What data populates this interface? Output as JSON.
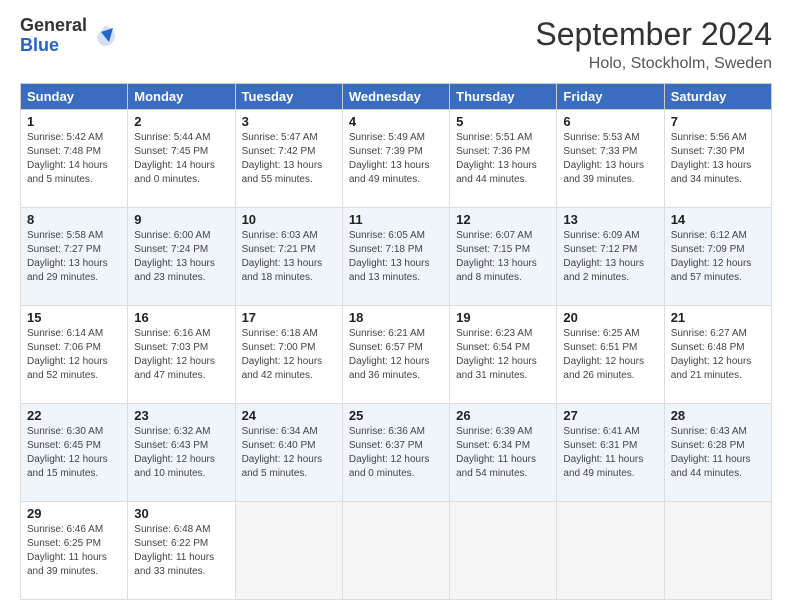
{
  "header": {
    "logo_line1": "General",
    "logo_line2": "Blue",
    "month": "September 2024",
    "location": "Holo, Stockholm, Sweden"
  },
  "days_of_week": [
    "Sunday",
    "Monday",
    "Tuesday",
    "Wednesday",
    "Thursday",
    "Friday",
    "Saturday"
  ],
  "weeks": [
    [
      {
        "day": "1",
        "sunrise": "Sunrise: 5:42 AM",
        "sunset": "Sunset: 7:48 PM",
        "daylight": "Daylight: 14 hours and 5 minutes."
      },
      {
        "day": "2",
        "sunrise": "Sunrise: 5:44 AM",
        "sunset": "Sunset: 7:45 PM",
        "daylight": "Daylight: 14 hours and 0 minutes."
      },
      {
        "day": "3",
        "sunrise": "Sunrise: 5:47 AM",
        "sunset": "Sunset: 7:42 PM",
        "daylight": "Daylight: 13 hours and 55 minutes."
      },
      {
        "day": "4",
        "sunrise": "Sunrise: 5:49 AM",
        "sunset": "Sunset: 7:39 PM",
        "daylight": "Daylight: 13 hours and 49 minutes."
      },
      {
        "day": "5",
        "sunrise": "Sunrise: 5:51 AM",
        "sunset": "Sunset: 7:36 PM",
        "daylight": "Daylight: 13 hours and 44 minutes."
      },
      {
        "day": "6",
        "sunrise": "Sunrise: 5:53 AM",
        "sunset": "Sunset: 7:33 PM",
        "daylight": "Daylight: 13 hours and 39 minutes."
      },
      {
        "day": "7",
        "sunrise": "Sunrise: 5:56 AM",
        "sunset": "Sunset: 7:30 PM",
        "daylight": "Daylight: 13 hours and 34 minutes."
      }
    ],
    [
      {
        "day": "8",
        "sunrise": "Sunrise: 5:58 AM",
        "sunset": "Sunset: 7:27 PM",
        "daylight": "Daylight: 13 hours and 29 minutes."
      },
      {
        "day": "9",
        "sunrise": "Sunrise: 6:00 AM",
        "sunset": "Sunset: 7:24 PM",
        "daylight": "Daylight: 13 hours and 23 minutes."
      },
      {
        "day": "10",
        "sunrise": "Sunrise: 6:03 AM",
        "sunset": "Sunset: 7:21 PM",
        "daylight": "Daylight: 13 hours and 18 minutes."
      },
      {
        "day": "11",
        "sunrise": "Sunrise: 6:05 AM",
        "sunset": "Sunset: 7:18 PM",
        "daylight": "Daylight: 13 hours and 13 minutes."
      },
      {
        "day": "12",
        "sunrise": "Sunrise: 6:07 AM",
        "sunset": "Sunset: 7:15 PM",
        "daylight": "Daylight: 13 hours and 8 minutes."
      },
      {
        "day": "13",
        "sunrise": "Sunrise: 6:09 AM",
        "sunset": "Sunset: 7:12 PM",
        "daylight": "Daylight: 13 hours and 2 minutes."
      },
      {
        "day": "14",
        "sunrise": "Sunrise: 6:12 AM",
        "sunset": "Sunset: 7:09 PM",
        "daylight": "Daylight: 12 hours and 57 minutes."
      }
    ],
    [
      {
        "day": "15",
        "sunrise": "Sunrise: 6:14 AM",
        "sunset": "Sunset: 7:06 PM",
        "daylight": "Daylight: 12 hours and 52 minutes."
      },
      {
        "day": "16",
        "sunrise": "Sunrise: 6:16 AM",
        "sunset": "Sunset: 7:03 PM",
        "daylight": "Daylight: 12 hours and 47 minutes."
      },
      {
        "day": "17",
        "sunrise": "Sunrise: 6:18 AM",
        "sunset": "Sunset: 7:00 PM",
        "daylight": "Daylight: 12 hours and 42 minutes."
      },
      {
        "day": "18",
        "sunrise": "Sunrise: 6:21 AM",
        "sunset": "Sunset: 6:57 PM",
        "daylight": "Daylight: 12 hours and 36 minutes."
      },
      {
        "day": "19",
        "sunrise": "Sunrise: 6:23 AM",
        "sunset": "Sunset: 6:54 PM",
        "daylight": "Daylight: 12 hours and 31 minutes."
      },
      {
        "day": "20",
        "sunrise": "Sunrise: 6:25 AM",
        "sunset": "Sunset: 6:51 PM",
        "daylight": "Daylight: 12 hours and 26 minutes."
      },
      {
        "day": "21",
        "sunrise": "Sunrise: 6:27 AM",
        "sunset": "Sunset: 6:48 PM",
        "daylight": "Daylight: 12 hours and 21 minutes."
      }
    ],
    [
      {
        "day": "22",
        "sunrise": "Sunrise: 6:30 AM",
        "sunset": "Sunset: 6:45 PM",
        "daylight": "Daylight: 12 hours and 15 minutes."
      },
      {
        "day": "23",
        "sunrise": "Sunrise: 6:32 AM",
        "sunset": "Sunset: 6:43 PM",
        "daylight": "Daylight: 12 hours and 10 minutes."
      },
      {
        "day": "24",
        "sunrise": "Sunrise: 6:34 AM",
        "sunset": "Sunset: 6:40 PM",
        "daylight": "Daylight: 12 hours and 5 minutes."
      },
      {
        "day": "25",
        "sunrise": "Sunrise: 6:36 AM",
        "sunset": "Sunset: 6:37 PM",
        "daylight": "Daylight: 12 hours and 0 minutes."
      },
      {
        "day": "26",
        "sunrise": "Sunrise: 6:39 AM",
        "sunset": "Sunset: 6:34 PM",
        "daylight": "Daylight: 11 hours and 54 minutes."
      },
      {
        "day": "27",
        "sunrise": "Sunrise: 6:41 AM",
        "sunset": "Sunset: 6:31 PM",
        "daylight": "Daylight: 11 hours and 49 minutes."
      },
      {
        "day": "28",
        "sunrise": "Sunrise: 6:43 AM",
        "sunset": "Sunset: 6:28 PM",
        "daylight": "Daylight: 11 hours and 44 minutes."
      }
    ],
    [
      {
        "day": "29",
        "sunrise": "Sunrise: 6:46 AM",
        "sunset": "Sunset: 6:25 PM",
        "daylight": "Daylight: 11 hours and 39 minutes."
      },
      {
        "day": "30",
        "sunrise": "Sunrise: 6:48 AM",
        "sunset": "Sunset: 6:22 PM",
        "daylight": "Daylight: 11 hours and 33 minutes."
      },
      null,
      null,
      null,
      null,
      null
    ]
  ]
}
